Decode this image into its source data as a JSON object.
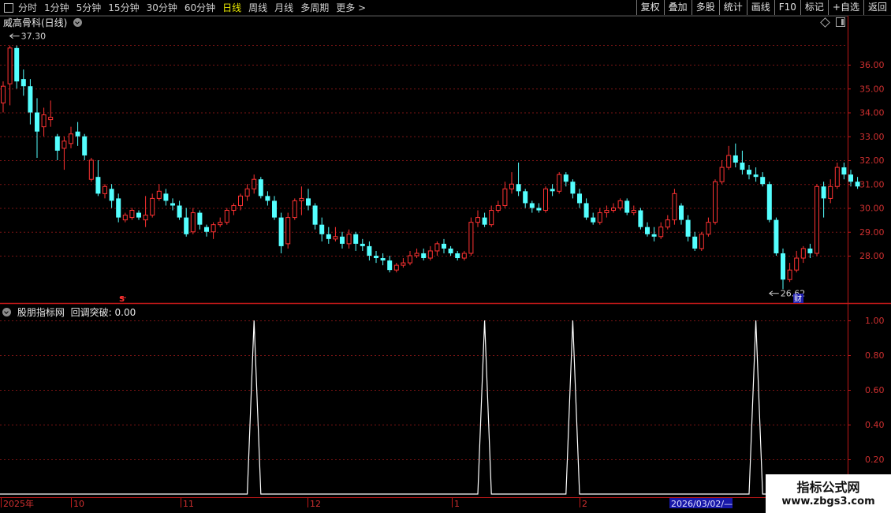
{
  "toolbar": {
    "periods": [
      "分时",
      "1分钟",
      "5分钟",
      "15分钟",
      "30分钟",
      "60分钟",
      "日线",
      "周线",
      "月线",
      "多周期",
      "更多 >"
    ],
    "active": "日线",
    "right_buttons": [
      "复权",
      "叠加",
      "多股",
      "统计",
      "画线",
      "F10",
      "标记",
      "+自选",
      "返回"
    ]
  },
  "main_chart": {
    "stock_name": "威高骨科(日线)",
    "price_axis_ticks": [
      "36.00",
      "35.00",
      "34.00",
      "33.00",
      "32.00",
      "31.00",
      "30.00",
      "29.00",
      "28.00"
    ],
    "max_label": "37.30",
    "min_label": "26.62",
    "finance_marker": "财",
    "dividend_marker": "S"
  },
  "indicator": {
    "title": "股朋指标网",
    "series_label": "回调突破: 0.00",
    "axis_ticks": [
      "1.00",
      "0.80",
      "0.60",
      "0.40",
      "0.20"
    ]
  },
  "time_axis": {
    "labels": [
      "2025年",
      "10",
      "11",
      "12",
      "1",
      "2"
    ],
    "cursor_date": "2026/03/02/—"
  },
  "watermark": {
    "title": "指标公式网",
    "url": "www.zbgs3.com"
  },
  "chart_data": {
    "type": "candlestick",
    "price_range": [
      26.0,
      38.0
    ],
    "up_color": "#ff3232",
    "down_color": "#54ffff",
    "candles": [
      [
        34.4,
        35.1,
        35.3,
        34.0
      ],
      [
        35.2,
        36.7,
        36.8,
        34.3
      ],
      [
        36.7,
        35.3,
        36.8,
        35.0
      ],
      [
        35.4,
        35.1,
        35.8,
        34.7
      ],
      [
        35.1,
        34.0,
        35.4,
        33.5
      ],
      [
        34.0,
        33.2,
        34.6,
        32.1
      ],
      [
        33.4,
        33.9,
        34.2,
        33.0
      ],
      [
        33.7,
        33.8,
        34.5,
        33.4
      ],
      [
        33.0,
        32.4,
        33.1,
        32.0
      ],
      [
        32.5,
        32.8,
        33.0,
        31.6
      ],
      [
        32.7,
        33.1,
        33.4,
        32.5
      ],
      [
        33.2,
        33.0,
        33.6,
        32.6
      ],
      [
        33.0,
        32.2,
        33.1,
        32.0
      ],
      [
        31.2,
        32.0,
        32.1,
        31.1
      ],
      [
        31.3,
        30.6,
        32.0,
        30.5
      ],
      [
        30.6,
        30.9,
        31.0,
        30.4
      ],
      [
        30.8,
        30.3,
        31.0,
        30.0
      ],
      [
        30.4,
        29.6,
        30.6,
        29.4
      ],
      [
        29.5,
        29.7,
        29.8,
        29.4
      ],
      [
        29.6,
        29.9,
        30.0,
        29.5
      ],
      [
        29.8,
        29.6,
        29.9,
        29.5
      ],
      [
        29.5,
        29.7,
        30.5,
        29.2
      ],
      [
        29.7,
        30.4,
        30.6,
        29.6
      ],
      [
        30.4,
        30.7,
        31.0,
        30.3
      ],
      [
        30.6,
        30.3,
        30.8,
        30.1
      ],
      [
        30.2,
        30.1,
        30.4,
        29.9
      ],
      [
        30.1,
        29.6,
        30.3,
        29.5
      ],
      [
        29.6,
        28.9,
        30.0,
        28.8
      ],
      [
        29.0,
        29.8,
        30.0,
        28.9
      ],
      [
        29.8,
        29.3,
        29.9,
        29.1
      ],
      [
        29.2,
        29.0,
        29.3,
        28.8
      ],
      [
        29.0,
        29.3,
        29.4,
        28.7
      ],
      [
        29.3,
        29.4,
        29.6,
        29.2
      ],
      [
        29.4,
        29.9,
        30.0,
        29.3
      ],
      [
        29.9,
        30.1,
        30.2,
        29.7
      ],
      [
        30.1,
        30.5,
        30.6,
        29.9
      ],
      [
        30.5,
        30.8,
        31.0,
        30.3
      ],
      [
        30.8,
        31.2,
        31.4,
        30.6
      ],
      [
        31.2,
        30.5,
        31.3,
        30.4
      ],
      [
        30.5,
        30.3,
        30.7,
        30.1
      ],
      [
        30.3,
        29.6,
        30.5,
        29.5
      ],
      [
        29.6,
        28.4,
        29.8,
        28.1
      ],
      [
        28.5,
        29.6,
        29.8,
        28.3
      ],
      [
        29.6,
        30.3,
        30.4,
        29.5
      ],
      [
        30.3,
        30.4,
        30.9,
        29.7
      ],
      [
        30.4,
        30.1,
        30.8,
        29.9
      ],
      [
        30.1,
        29.3,
        30.2,
        29.1
      ],
      [
        29.3,
        28.9,
        29.6,
        28.6
      ],
      [
        28.9,
        28.7,
        29.2,
        28.5
      ],
      [
        28.7,
        28.8,
        29.2,
        28.6
      ],
      [
        28.8,
        28.5,
        29.0,
        28.3
      ],
      [
        28.5,
        28.9,
        29.1,
        28.3
      ],
      [
        28.9,
        28.5,
        29.0,
        28.2
      ],
      [
        28.5,
        28.4,
        28.7,
        28.2
      ],
      [
        28.4,
        28.0,
        28.6,
        27.8
      ],
      [
        28.0,
        27.9,
        28.2,
        27.7
      ],
      [
        27.9,
        27.8,
        28.1,
        27.6
      ],
      [
        27.8,
        27.4,
        28.0,
        27.3
      ],
      [
        27.4,
        27.6,
        27.7,
        27.3
      ],
      [
        27.6,
        27.7,
        27.9,
        27.5
      ],
      [
        27.7,
        28.0,
        28.2,
        27.6
      ],
      [
        28.0,
        28.1,
        28.3,
        27.9
      ],
      [
        28.1,
        27.9,
        28.3,
        27.8
      ],
      [
        27.9,
        28.2,
        28.4,
        27.8
      ],
      [
        28.2,
        28.5,
        28.6,
        28.0
      ],
      [
        28.5,
        28.3,
        28.7,
        28.1
      ],
      [
        28.3,
        28.1,
        28.4,
        28.0
      ],
      [
        28.1,
        27.9,
        28.2,
        27.8
      ],
      [
        27.9,
        28.1,
        28.2,
        27.8
      ],
      [
        28.1,
        29.4,
        29.6,
        28.0
      ],
      [
        29.4,
        29.6,
        29.9,
        29.2
      ],
      [
        29.6,
        29.3,
        29.8,
        29.2
      ],
      [
        29.3,
        29.9,
        30.1,
        29.2
      ],
      [
        29.9,
        30.1,
        30.3,
        29.8
      ],
      [
        30.1,
        30.8,
        31.1,
        30.0
      ],
      [
        30.8,
        31.0,
        31.5,
        30.6
      ],
      [
        31.0,
        30.7,
        31.9,
        30.5
      ],
      [
        30.7,
        30.2,
        30.8,
        30.0
      ],
      [
        30.2,
        30.0,
        30.3,
        29.8
      ],
      [
        30.0,
        29.9,
        30.2,
        29.8
      ],
      [
        29.9,
        30.8,
        30.9,
        29.8
      ],
      [
        30.8,
        30.7,
        31.0,
        30.5
      ],
      [
        30.7,
        31.4,
        31.5,
        30.6
      ],
      [
        31.4,
        31.1,
        31.5,
        30.9
      ],
      [
        31.1,
        30.6,
        31.2,
        30.4
      ],
      [
        30.6,
        30.2,
        30.8,
        30.0
      ],
      [
        30.2,
        29.6,
        30.4,
        29.5
      ],
      [
        29.6,
        29.4,
        29.8,
        29.3
      ],
      [
        29.4,
        29.8,
        30.0,
        29.3
      ],
      [
        29.8,
        29.9,
        30.1,
        29.6
      ],
      [
        29.9,
        30.0,
        30.2,
        29.8
      ],
      [
        30.0,
        30.3,
        30.4,
        29.9
      ],
      [
        30.3,
        29.8,
        30.4,
        29.7
      ],
      [
        29.8,
        29.9,
        30.1,
        29.7
      ],
      [
        29.9,
        29.2,
        30.0,
        29.1
      ],
      [
        29.2,
        28.9,
        29.4,
        28.8
      ],
      [
        28.9,
        28.8,
        29.2,
        28.6
      ],
      [
        28.8,
        29.2,
        29.4,
        28.7
      ],
      [
        29.2,
        29.5,
        29.7,
        29.1
      ],
      [
        29.5,
        30.6,
        30.8,
        29.3
      ],
      [
        30.1,
        29.5,
        30.2,
        29.3
      ],
      [
        29.5,
        28.8,
        29.7,
        28.6
      ],
      [
        28.8,
        28.3,
        29.0,
        28.2
      ],
      [
        28.3,
        28.9,
        29.0,
        28.2
      ],
      [
        28.9,
        29.4,
        29.6,
        28.8
      ],
      [
        29.4,
        31.1,
        31.2,
        29.3
      ],
      [
        31.1,
        31.7,
        32.0,
        31.0
      ],
      [
        31.7,
        32.2,
        32.6,
        31.6
      ],
      [
        32.2,
        31.9,
        32.7,
        31.7
      ],
      [
        31.9,
        31.6,
        32.4,
        31.4
      ],
      [
        31.6,
        31.4,
        31.8,
        31.2
      ],
      [
        31.4,
        31.3,
        31.7,
        31.1
      ],
      [
        31.3,
        31.0,
        31.5,
        30.9
      ],
      [
        31.0,
        29.5,
        31.1,
        29.4
      ],
      [
        29.5,
        28.1,
        29.6,
        28.0
      ],
      [
        28.1,
        27.0,
        28.3,
        26.6
      ],
      [
        27.0,
        27.4,
        27.7,
        26.9
      ],
      [
        27.4,
        27.9,
        28.2,
        27.3
      ],
      [
        27.9,
        28.3,
        28.4,
        27.7
      ],
      [
        28.3,
        28.1,
        28.5,
        27.9
      ],
      [
        28.1,
        30.9,
        31.0,
        28.0
      ],
      [
        30.9,
        30.4,
        31.1,
        29.6
      ],
      [
        30.4,
        30.9,
        31.2,
        30.2
      ],
      [
        30.9,
        31.7,
        31.9,
        30.8
      ],
      [
        31.7,
        31.4,
        31.9,
        31.2
      ],
      [
        31.4,
        31.1,
        31.6,
        30.9
      ],
      [
        31.1,
        30.9,
        31.3,
        30.8
      ]
    ],
    "indicator": {
      "name": "回调突破",
      "range": [
        0,
        1
      ],
      "spike_candle_indices": [
        37,
        71,
        84,
        111
      ]
    }
  }
}
